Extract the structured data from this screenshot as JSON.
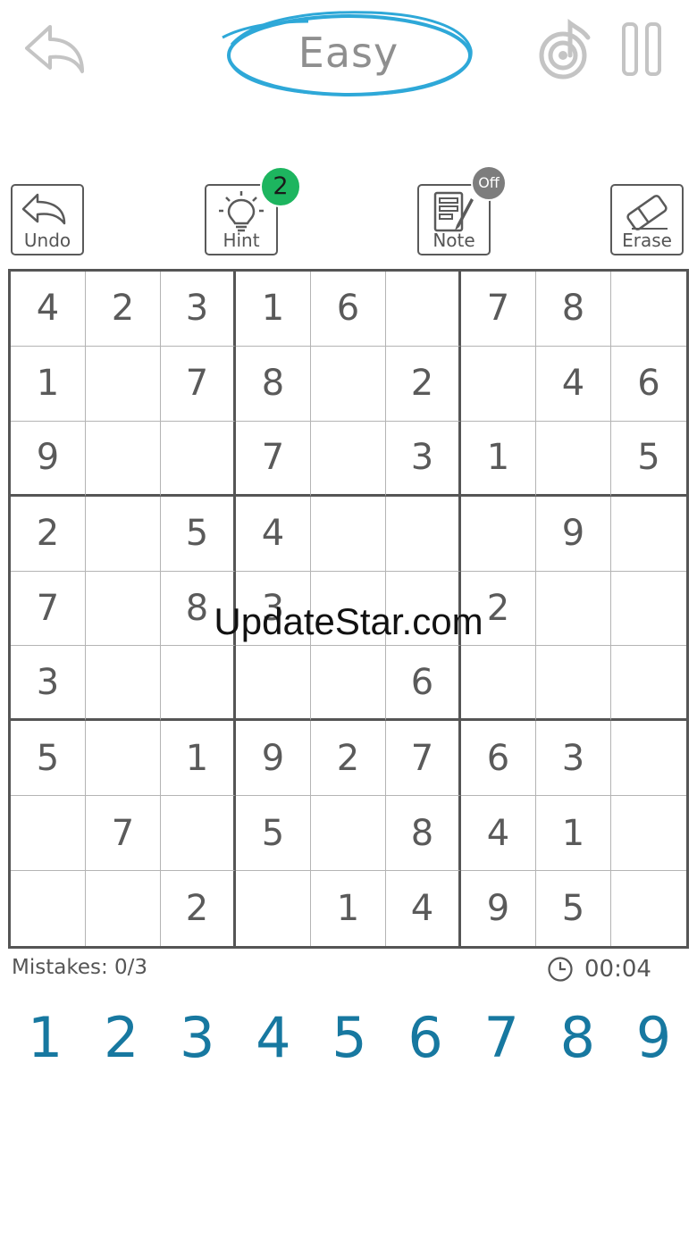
{
  "header": {
    "difficulty": "Easy",
    "ring_color": "#2ea8d8"
  },
  "tools": {
    "undo": {
      "label": "Undo",
      "icon": "undo-arrow-icon"
    },
    "hint": {
      "label": "Hint",
      "icon": "lightbulb-icon",
      "count": "2",
      "badge_color": "#1db55f"
    },
    "note": {
      "label": "Note",
      "icon": "notepad-pencil-icon",
      "state": "Off"
    },
    "erase": {
      "label": "Erase",
      "icon": "eraser-icon"
    }
  },
  "board": {
    "rows": [
      [
        "4",
        "2",
        "3",
        "1",
        "6",
        "",
        "7",
        "8",
        ""
      ],
      [
        "1",
        "",
        "7",
        "8",
        "",
        "2",
        "",
        "4",
        "6"
      ],
      [
        "9",
        "",
        "",
        "7",
        "",
        "3",
        "1",
        "",
        "5"
      ],
      [
        "2",
        "",
        "5",
        "4",
        "",
        "",
        "",
        "9",
        ""
      ],
      [
        "7",
        "",
        "8",
        "3",
        "",
        "",
        "2",
        "",
        ""
      ],
      [
        "3",
        "",
        "",
        "",
        "",
        "6",
        "",
        "",
        ""
      ],
      [
        "5",
        "",
        "1",
        "9",
        "2",
        "7",
        "6",
        "3",
        ""
      ],
      [
        "",
        "7",
        "",
        "5",
        "",
        "8",
        "4",
        "1",
        ""
      ],
      [
        "",
        "",
        "2",
        "",
        "1",
        "4",
        "9",
        "5",
        ""
      ]
    ]
  },
  "watermark": "UpdateStar.com",
  "status": {
    "mistakes": "Mistakes: 0/3",
    "timer": "00:04"
  },
  "numpad": [
    "1",
    "2",
    "3",
    "4",
    "5",
    "6",
    "7",
    "8",
    "9"
  ],
  "colors": {
    "numpad": "#1778a0",
    "grid": "#555555"
  }
}
